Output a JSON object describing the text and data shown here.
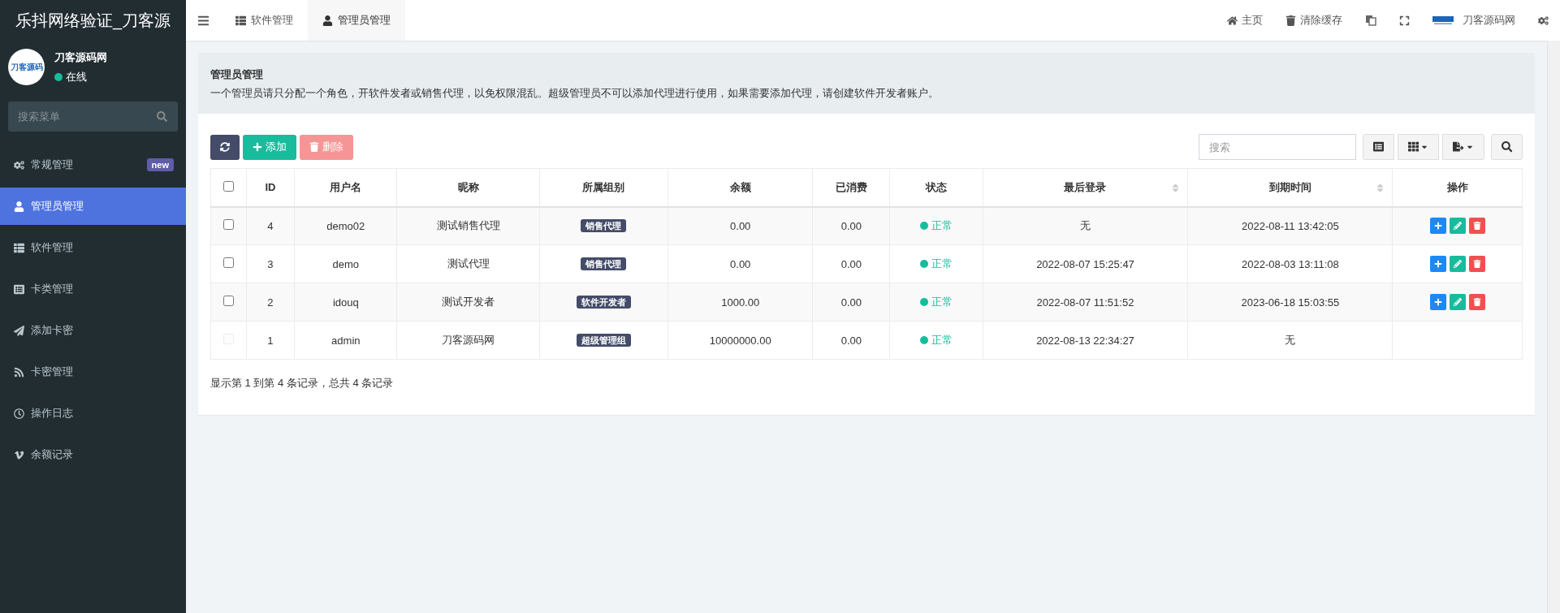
{
  "sidebar": {
    "title": "乐抖网络验证_刀客源",
    "user": {
      "logo_text": "刀客源码",
      "name": "刀客源码网",
      "status": "在线"
    },
    "search": {
      "placeholder": "搜索菜单"
    },
    "items": [
      {
        "label": "常规管理",
        "badge": "new",
        "selected": false
      },
      {
        "label": "管理员管理",
        "selected": true
      },
      {
        "label": "软件管理",
        "selected": false
      },
      {
        "label": "卡类管理",
        "selected": false
      },
      {
        "label": "添加卡密",
        "selected": false
      },
      {
        "label": "卡密管理",
        "selected": false
      },
      {
        "label": "操作日志",
        "selected": false
      },
      {
        "label": "余额记录",
        "selected": false
      }
    ]
  },
  "topbar": {
    "tabs": [
      {
        "label": "软件管理",
        "selected": false
      },
      {
        "label": "管理员管理",
        "selected": true
      }
    ],
    "actions": [
      {
        "kind": "link",
        "label": "主页"
      },
      {
        "kind": "link",
        "label": "清除缓存"
      },
      {
        "kind": "icon"
      },
      {
        "kind": "icon"
      },
      {
        "kind": "brand",
        "label": "刀客源码网"
      },
      {
        "kind": "icon"
      }
    ]
  },
  "panel": {
    "title": "管理员管理",
    "description": "一个管理员请只分配一个角色，开软件发者或销售代理，以免权限混乱。超级管理员不可以添加代理进行使用，如果需要添加代理，请创建软件开发者账户。"
  },
  "toolbar": {
    "buttons": [
      {
        "kind": "refresh",
        "disabled": false
      },
      {
        "kind": "add",
        "label": "添加",
        "disabled": false
      },
      {
        "kind": "delete",
        "label": "删除",
        "disabled": true
      }
    ],
    "search": {
      "placeholder": "搜索"
    }
  },
  "table": {
    "select_all": {
      "checked": false
    },
    "columns": [
      {
        "label": "ID",
        "sortable": false
      },
      {
        "label": "用户名",
        "sortable": false
      },
      {
        "label": "昵称",
        "sortable": false
      },
      {
        "label": "所属组别",
        "sortable": false
      },
      {
        "label": "余额",
        "sortable": false
      },
      {
        "label": "已消费",
        "sortable": false
      },
      {
        "label": "状态",
        "sortable": false
      },
      {
        "label": "最后登录",
        "sortable": true
      },
      {
        "label": "到期时间",
        "sortable": true
      },
      {
        "label": "操作",
        "sortable": false
      }
    ],
    "rows": [
      {
        "checked": false,
        "disabled": false,
        "id": "4",
        "username": "demo02",
        "nickname": "测试销售代理",
        "group": "销售代理",
        "balance": "0.00",
        "spent": "0.00",
        "status": "正常",
        "last_login": "无",
        "expires": "2022-08-11 13:42:05",
        "actions": [
          {
            "kind": "add"
          },
          {
            "kind": "edit"
          },
          {
            "kind": "delete"
          }
        ]
      },
      {
        "checked": false,
        "disabled": false,
        "id": "3",
        "username": "demo",
        "nickname": "测试代理",
        "group": "销售代理",
        "balance": "0.00",
        "spent": "0.00",
        "status": "正常",
        "last_login": "2022-08-07 15:25:47",
        "expires": "2022-08-03 13:11:08",
        "actions": [
          {
            "kind": "add"
          },
          {
            "kind": "edit"
          },
          {
            "kind": "delete"
          }
        ]
      },
      {
        "checked": false,
        "disabled": false,
        "id": "2",
        "username": "idouq",
        "nickname": "测试开发者",
        "group": "软件开发者",
        "balance": "1000.00",
        "spent": "0.00",
        "status": "正常",
        "last_login": "2022-08-07 11:51:52",
        "expires": "2023-06-18 15:03:55",
        "actions": [
          {
            "kind": "add"
          },
          {
            "kind": "edit"
          },
          {
            "kind": "delete"
          }
        ]
      },
      {
        "checked": false,
        "disabled": true,
        "id": "1",
        "username": "admin",
        "nickname": "刀客源码网",
        "group": "超级管理组",
        "balance": "10000000.00",
        "spent": "0.00",
        "status": "正常",
        "last_login": "2022-08-13 22:34:27",
        "expires": "无"
      }
    ]
  },
  "pagination": {
    "summary": "显示第 1 到第 4 条记录，总共 4 条记录"
  }
}
